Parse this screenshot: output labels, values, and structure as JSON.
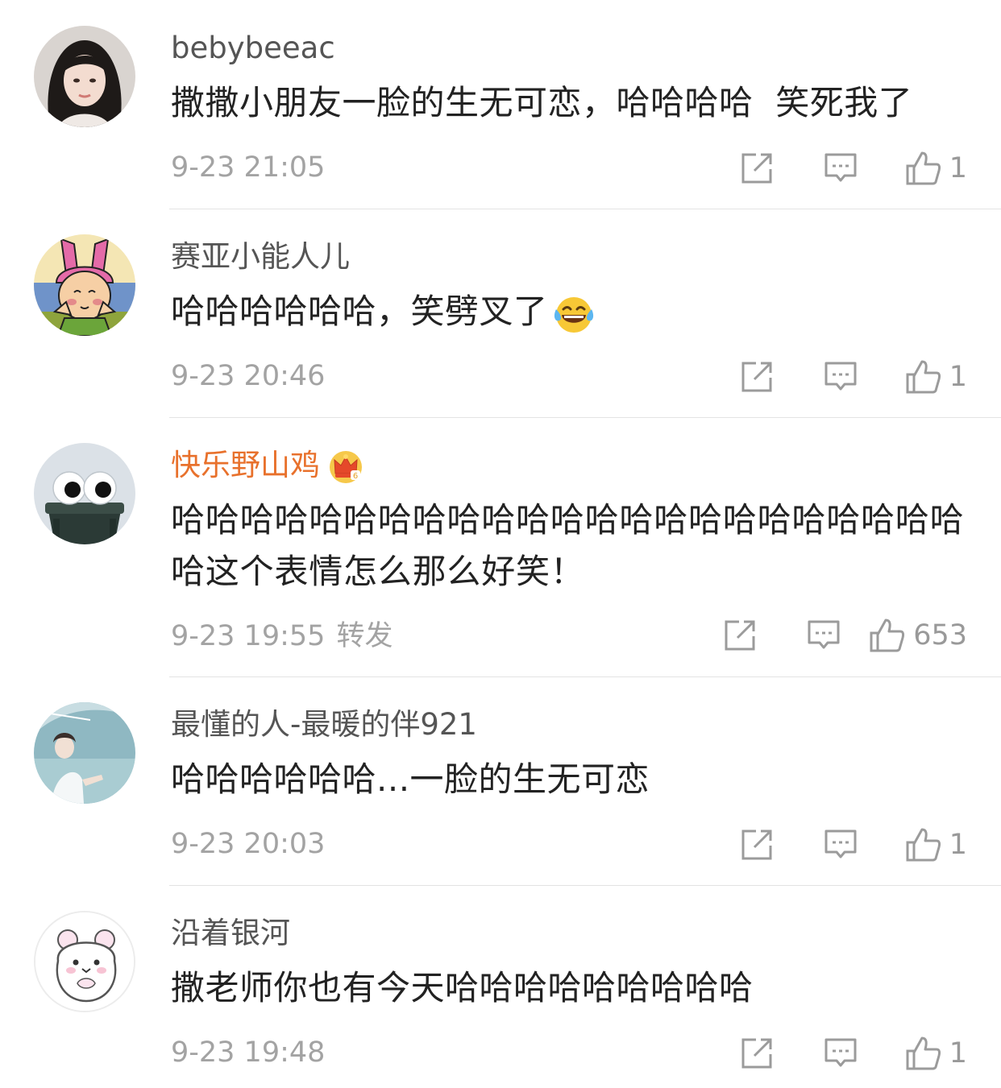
{
  "comments": [
    {
      "username": "bebybeeac",
      "vip": false,
      "text": "撒撒小朋友一脸的生无可恋，哈哈哈哈  笑死我了",
      "time": "9-23 21:05",
      "repost": "",
      "likes": "1",
      "avatar_icon": "girl-portrait-avatar"
    },
    {
      "username": "赛亚小能人儿",
      "vip": false,
      "text": "哈哈哈哈哈哈，笑劈叉了",
      "emoji": "laughing-tears-emoji",
      "time": "9-23 20:46",
      "repost": "",
      "likes": "1",
      "avatar_icon": "cartoon-bunny-ears-avatar"
    },
    {
      "username": "快乐野山鸡",
      "vip": true,
      "vip_icon": "crown-icon",
      "text": "哈哈哈哈哈哈哈哈哈哈哈哈哈哈哈哈哈哈哈哈哈哈哈哈这个表情怎么那么好笑！",
      "time": "9-23 19:55",
      "repost": "转发",
      "likes": "653",
      "avatar_icon": "googly-eyes-trash-bin-avatar"
    },
    {
      "username": "最懂的人-最暖的伴921",
      "vip": false,
      "text": "哈哈哈哈哈哈...一脸的生无可恋",
      "time": "9-23 20:03",
      "repost": "",
      "likes": "1",
      "avatar_icon": "girl-umbrella-avatar"
    },
    {
      "username": "沿着银河",
      "vip": false,
      "text": "撒老师你也有今天哈哈哈哈哈哈哈哈哈",
      "time": "9-23 19:48",
      "repost": "",
      "likes": "1",
      "avatar_icon": "hamster-avatar"
    }
  ],
  "colors": {
    "username": "#555555",
    "vip_username": "#e8712c",
    "text": "#222222",
    "meta": "#a3a3a3",
    "divider": "#e3e3e3"
  }
}
